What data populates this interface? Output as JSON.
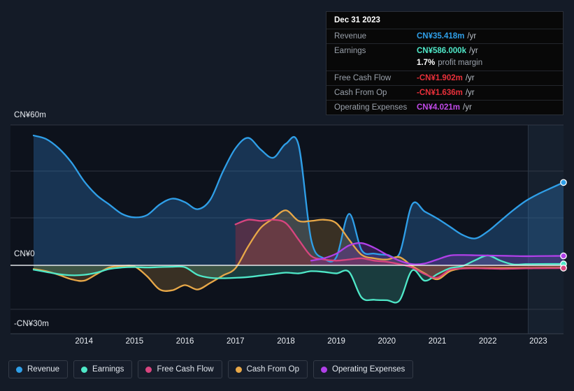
{
  "axes": {
    "y_top_label": "CN¥60m",
    "y_zero_label": "CN¥0",
    "y_bottom_label": "-CN¥30m",
    "x_ticks": [
      "2014",
      "2015",
      "2016",
      "2017",
      "2018",
      "2019",
      "2020",
      "2021",
      "2022",
      "2023"
    ]
  },
  "tooltip": {
    "date": "Dec 31 2023",
    "rows": [
      {
        "label": "Revenue",
        "value": "CN¥35.418m",
        "unit": "/yr",
        "color": "#2f9fe8"
      },
      {
        "label": "Earnings",
        "value": "CN¥586.000k",
        "unit": "/yr",
        "color": "#4fe8c8"
      },
      {
        "label": "Free Cash Flow",
        "value": "-CN¥1.902m",
        "unit": "/yr",
        "color": "#e8303a"
      },
      {
        "label": "Cash From Op",
        "value": "-CN¥1.636m",
        "unit": "/yr",
        "color": "#e8303a"
      },
      {
        "label": "Operating Expenses",
        "value": "CN¥4.021m",
        "unit": "/yr",
        "color": "#c04ae8"
      }
    ],
    "margin_value": "1.7%",
    "margin_text": "profit margin"
  },
  "legend": [
    {
      "label": "Revenue",
      "color": "#2f9fe8"
    },
    {
      "label": "Earnings",
      "color": "#4fe8c8"
    },
    {
      "label": "Free Cash Flow",
      "color": "#d8457f"
    },
    {
      "label": "Cash From Op",
      "color": "#e8a848"
    },
    {
      "label": "Operating Expenses",
      "color": "#b040e8"
    }
  ],
  "chart_data": {
    "type": "area",
    "title": "",
    "xlabel": "",
    "ylabel": "CN¥",
    "ylim": [
      -30,
      60
    ],
    "y_ticks": [
      60,
      0,
      -30
    ],
    "grid": true,
    "legend_position": "bottom",
    "x_range": [
      "2013-06",
      "2024-03"
    ],
    "forecast_region_start": "2023-04",
    "x": [
      2013.5,
      2013.75,
      2014.0,
      2014.25,
      2014.5,
      2014.75,
      2015.0,
      2015.25,
      2015.5,
      2015.75,
      2016.0,
      2016.25,
      2016.5,
      2016.75,
      2017.0,
      2017.25,
      2017.5,
      2017.75,
      2018.0,
      2018.25,
      2018.5,
      2018.75,
      2019.0,
      2019.25,
      2019.5,
      2019.75,
      2020.0,
      2020.25,
      2020.5,
      2020.75,
      2021.0,
      2021.25,
      2021.5,
      2021.75,
      2022.0,
      2022.25,
      2022.5,
      2022.75,
      2023.0,
      2023.25,
      2023.5,
      2023.75,
      2024.0
    ],
    "series": [
      {
        "name": "Revenue",
        "color": "#2f9fe8",
        "fill": "rgba(47,120,190,0.34)",
        "values": [
          55.5,
          54.0,
          50.0,
          44.0,
          36.0,
          30.0,
          26.0,
          22.0,
          20.5,
          21.5,
          26.0,
          28.5,
          27.0,
          24.0,
          28.0,
          40.0,
          50.0,
          54.5,
          49.5,
          46.0,
          52.0,
          51.5,
          11.0,
          3.0,
          3.5,
          22.0,
          6.5,
          5.0,
          4.5,
          5.0,
          26.0,
          23.0,
          20.0,
          16.5,
          13.0,
          11.5,
          14.5,
          19.0,
          23.5,
          27.5,
          30.5,
          33.0,
          35.418
        ]
      },
      {
        "name": "Earnings",
        "color": "#4fe8c8",
        "fill": "rgba(79,232,200,0.20)",
        "values": [
          -3.0,
          -4.5,
          -6.0,
          -6.8,
          -6.5,
          -5.0,
          -2.5,
          -1.5,
          -1.2,
          -1.5,
          -1.2,
          -1.0,
          -1.3,
          -6.5,
          -8.5,
          -8.8,
          -8.5,
          -8.0,
          -7.0,
          -6.0,
          -5.0,
          -5.5,
          -4.0,
          -4.5,
          -5.5,
          -4.5,
          -22.0,
          -23.5,
          -23.8,
          -24.0,
          -3.5,
          -10.5,
          -6.0,
          -2.0,
          -0.5,
          2.2,
          4.2,
          2.0,
          0.4,
          0.5,
          0.55,
          0.58,
          0.586
        ]
      },
      {
        "name": "Free Cash Flow",
        "color": "#d8457f",
        "fill": "rgba(150,45,60,0.45)",
        "values": [
          null,
          null,
          null,
          null,
          null,
          null,
          null,
          null,
          null,
          null,
          null,
          null,
          null,
          null,
          null,
          null,
          17.5,
          19.5,
          19.0,
          19.5,
          18.0,
          11.0,
          4.0,
          2.5,
          2.0,
          2.5,
          3.0,
          2.0,
          1.5,
          0.5,
          -1.5,
          -6.0,
          -8.5,
          -3.0,
          -2.2,
          -2.0,
          -2.2,
          -2.4,
          -2.3,
          -2.1,
          -2.0,
          -1.95,
          -1.902
        ]
      },
      {
        "name": "Cash From Op",
        "color": "#e8a848",
        "fill": "rgba(160,120,55,0.30)",
        "values": [
          -2.5,
          -4.0,
          -6.5,
          -9.5,
          -10.5,
          -6.0,
          -1.5,
          -0.5,
          -0.8,
          -7.5,
          -16.5,
          -17.0,
          -13.5,
          -16.5,
          -12.0,
          -7.0,
          -2.0,
          8.0,
          16.0,
          20.0,
          23.5,
          19.0,
          19.0,
          19.5,
          18.0,
          11.0,
          4.5,
          3.0,
          2.5,
          3.5,
          -0.5,
          -5.5,
          -9.5,
          -4.0,
          -2.0,
          -1.8,
          -1.9,
          -2.0,
          -1.9,
          -1.8,
          -1.75,
          -1.7,
          -1.636
        ]
      },
      {
        "name": "Operating Expenses",
        "color": "#b040e8",
        "fill": "rgba(110,50,160,0.38)",
        "values": [
          null,
          null,
          null,
          null,
          null,
          null,
          null,
          null,
          null,
          null,
          null,
          null,
          null,
          null,
          null,
          null,
          null,
          null,
          null,
          null,
          null,
          null,
          2.0,
          3.0,
          5.0,
          8.5,
          9.5,
          7.5,
          4.5,
          2.0,
          0.5,
          0.8,
          2.5,
          4.2,
          4.4,
          4.3,
          4.2,
          4.1,
          4.0,
          3.9,
          3.95,
          4.0,
          4.021
        ]
      }
    ]
  }
}
